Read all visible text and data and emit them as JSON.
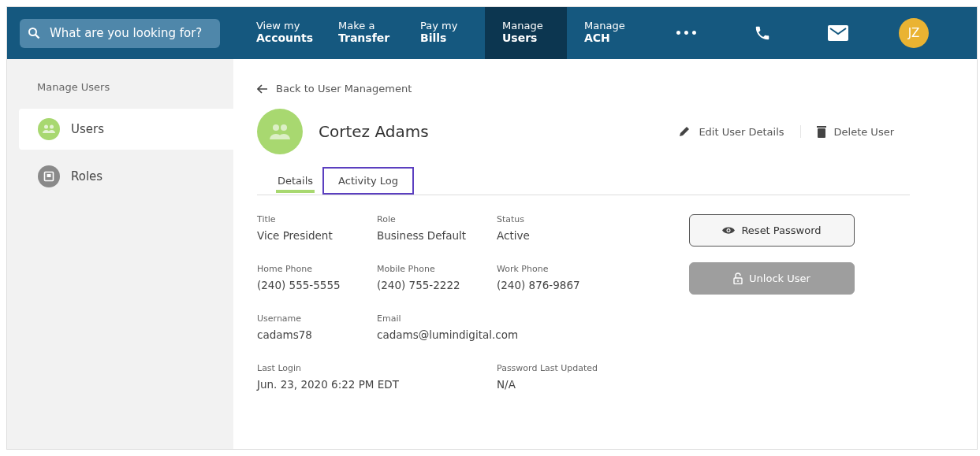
{
  "search": {
    "placeholder": "What are you looking for?"
  },
  "nav": [
    {
      "top": "View my",
      "bottom": "Accounts",
      "selected": false
    },
    {
      "top": "Make a",
      "bottom": "Transfer",
      "selected": false
    },
    {
      "top": "Pay my",
      "bottom": "Bills",
      "selected": false
    },
    {
      "top": "Manage",
      "bottom": "Users",
      "selected": true
    },
    {
      "top": "Manage",
      "bottom": "ACH",
      "selected": false
    }
  ],
  "more": "•••",
  "avatar": {
    "initials": "JZ"
  },
  "sidebar": {
    "heading": "Manage Users",
    "items": [
      {
        "label": "Users",
        "kind": "users",
        "selected": true
      },
      {
        "label": "Roles",
        "kind": "roles",
        "selected": false
      }
    ]
  },
  "back": "Back to User Management",
  "user": {
    "name": "Cortez Adams"
  },
  "actions": [
    {
      "label": "Edit User Details",
      "kind": "edit"
    },
    {
      "label": "Delete User",
      "kind": "delete"
    }
  ],
  "tabs": [
    {
      "label": "Details",
      "selected": true,
      "focused": false
    },
    {
      "label": "Activity Log",
      "selected": false,
      "focused": true
    }
  ],
  "fields": [
    [
      {
        "label": "Title",
        "value": "Vice President"
      },
      {
        "label": "Role",
        "value": "Business Default"
      },
      {
        "label": "Status",
        "value": "Active"
      }
    ],
    [
      {
        "label": "Home Phone",
        "value": "(240) 555-5555"
      },
      {
        "label": "Mobile Phone",
        "value": "(240) 755-2222"
      },
      {
        "label": "Work Phone",
        "value": "(240) 876-9867"
      }
    ],
    [
      {
        "label": "Username",
        "value": "cadams78"
      },
      {
        "label": "Email",
        "value": "cadams@lumindigital.com"
      }
    ],
    [
      {
        "label": "Last Login",
        "value": "Jun. 23, 2020 6:22 PM EDT"
      },
      {
        "label": "Password Last Updated",
        "value": "N/A"
      }
    ]
  ],
  "buttons": [
    {
      "label": "Reset Password",
      "kind": "reset",
      "disabled": false
    },
    {
      "label": "Unlock User",
      "kind": "unlock",
      "disabled": true
    }
  ]
}
